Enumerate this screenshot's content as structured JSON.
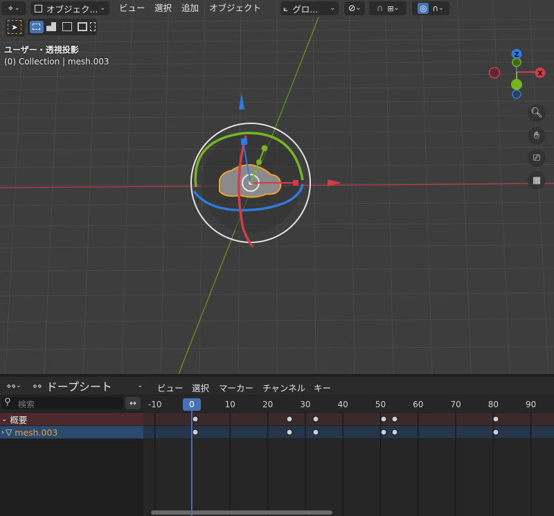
{
  "viewport": {
    "header": {
      "mode_label": "オブジェク...",
      "menus": [
        "ビュー",
        "選択",
        "追加",
        "オブジェクト"
      ],
      "orientation_label": "グロ..."
    },
    "overlay": {
      "view_name": "ユーザー・透視投影",
      "collection_info": "(0) Collection | mesh.003"
    },
    "gizmo": {
      "z": "Z",
      "x": "X"
    }
  },
  "dopesheet": {
    "editor_label": "ドープシート",
    "menus": [
      "ビュー",
      "選択",
      "マーカー",
      "チャンネル",
      "キー"
    ],
    "search_placeholder": "検索",
    "current_frame": "0",
    "ticks": [
      "-10",
      "20",
      "10",
      "30",
      "40",
      "50",
      "60",
      "70",
      "80",
      "90"
    ],
    "channels": [
      {
        "label": "概要",
        "type": "summary"
      },
      {
        "label": "mesh.003",
        "type": "object"
      }
    ],
    "keyframes": [
      0,
      25,
      32,
      50,
      53,
      80
    ]
  },
  "colors": {
    "accent": "#4772b3",
    "x_axis": "#d23c4b",
    "y_axis": "#78b41e",
    "z_axis": "#2e7be0",
    "selected_orange": "#f0a030"
  }
}
